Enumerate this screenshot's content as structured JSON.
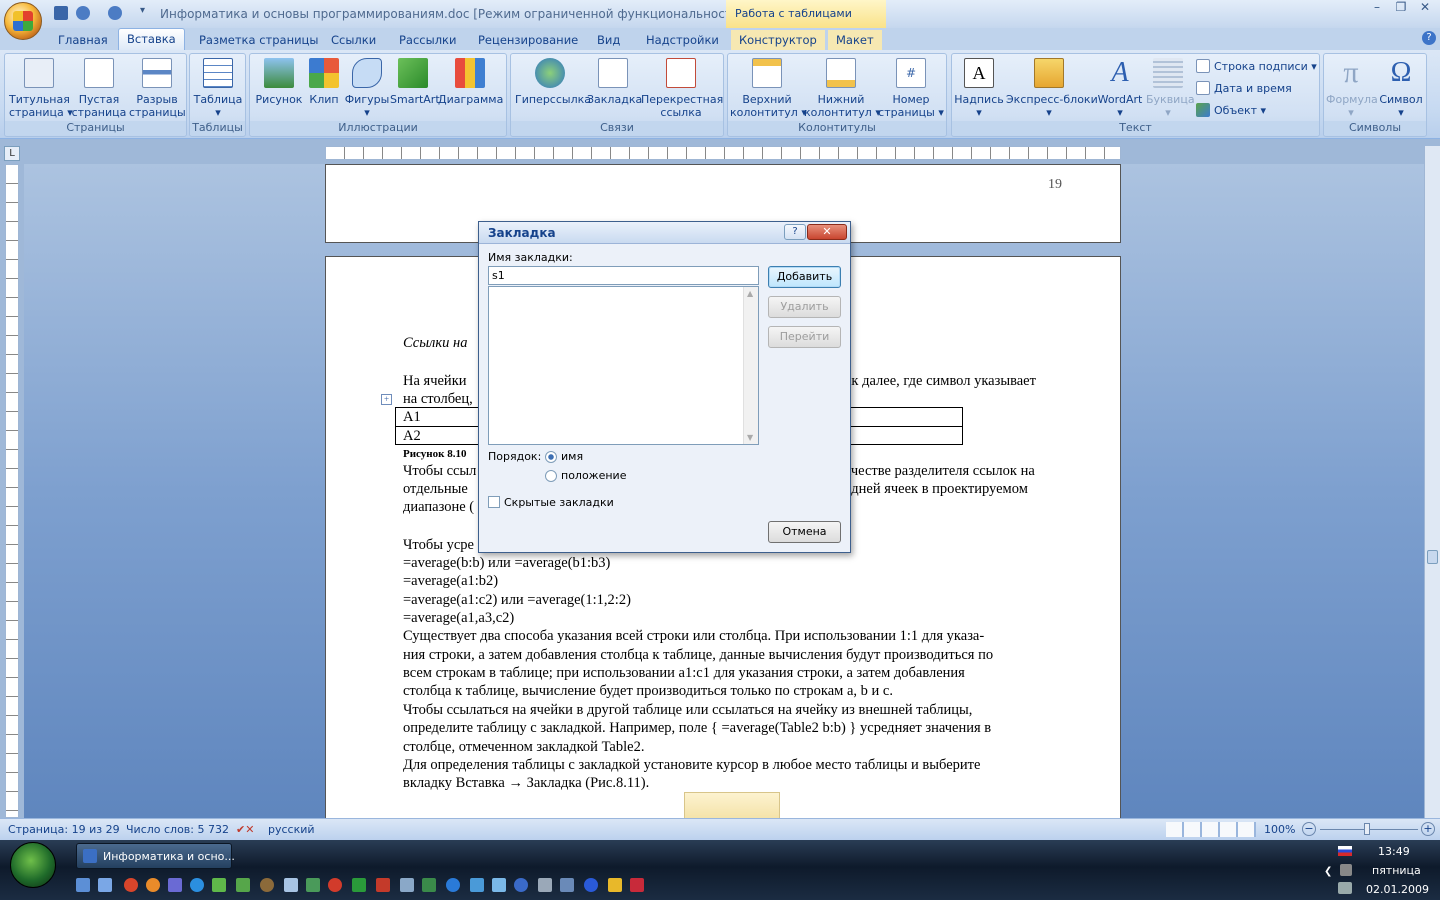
{
  "window": {
    "title": "Информатика и основы программированиям.doc [Режим ограниченной функциональности] - M...",
    "context_tab_title": "Работа с таблицами"
  },
  "tabs": [
    "Главная",
    "Вставка",
    "Разметка страницы",
    "Ссылки",
    "Рассылки",
    "Рецензирование",
    "Вид",
    "Надстройки",
    "Конструктор",
    "Макет"
  ],
  "ribbon": {
    "groups": [
      "Страницы",
      "Таблицы",
      "Иллюстрации",
      "Связи",
      "Колонтитулы",
      "Текст",
      "Символы"
    ],
    "pages": {
      "cover": "Титульная",
      "cover2": "страница ▾",
      "blank": "Пустая",
      "blank2": "страница",
      "break": "Разрыв",
      "break2": "страницы"
    },
    "tables": {
      "table": "Таблица",
      "table2": "▾"
    },
    "illustrations": {
      "picture": "Рисунок",
      "clip": "Клип",
      "shapes": "Фигуры",
      "shapes2": "▾",
      "smartart": "SmartArt",
      "chart": "Диаграмма"
    },
    "links": {
      "hyperlink": "Гиперссылка",
      "bookmark": "Закладка",
      "crossref": "Перекрестная",
      "crossref2": "ссылка"
    },
    "headers": {
      "header": "Верхний",
      "header2": "колонтитул ▾",
      "footer": "Нижний",
      "footer2": "колонтитул ▾",
      "pagenum": "Номер",
      "pagenum2": "страницы ▾"
    },
    "text": {
      "textbox": "Надпись",
      "quickparts": "Экспресс-блоки",
      "wordart": "WordArt",
      "dropcap": "Буквица",
      "signature": "Строка подписи ▾",
      "datetime": "Дата и время",
      "object": "Объект ▾"
    },
    "symbols": {
      "formula": "Формула",
      "symbol": "Символ"
    }
  },
  "document": {
    "page_number": "19",
    "lines": [
      "Ссылки на",
      "На ячейки",
      "ак далее, где символ указывает",
      "на столбец,",
      "A1",
      "A2",
      "Рисунок 8.10",
      "Чтобы ссыл",
      "ачестве разделителя ссылок на",
      "отдельные",
      "едней ячеек в проектируемом",
      "диапазоне (",
      "Чтобы усре",
      "=average(b:b) или =average(b1:b3)",
      "=average(a1:b2)",
      "=average(a1:c2) или =average(1:1,2:2)",
      "=average(a1,a3,c2)",
      "Существует два способа указания всей строки или столбца. При использовании 1:1 для указа-",
      "ния строки, а затем добавления столбца к таблице, данные вычисления будут производиться по",
      "всем строкам в таблице; при использовании a1:c1 для указания строки, а затем добавления",
      "столбца к таблице, вычисление будет производиться только по строкам a, b и c.",
      "Чтобы ссылаться на ячейки в другой таблице или ссылаться на ячейку из внешней таблицы,",
      "определите таблицу с закладкой. Например, поле { =average(Table2 b:b) } усредняет значения в",
      "столбце, отмеченном закладкой Table2.",
      "Для определения таблицы с закладкой установите курсор в любое место таблицы и выберите",
      "вкладку Вставка → Закладка (Рис.8.11)."
    ]
  },
  "dialog": {
    "title": "Закладка",
    "help": "?",
    "close": "✕",
    "name_label": "Имя закладки:",
    "name_value": "s1",
    "add": "Добавить",
    "delete": "Удалить",
    "goto": "Перейти",
    "order_label": "Порядок:",
    "order_name": "имя",
    "order_position": "положение",
    "hidden": "Скрытые закладки",
    "cancel": "Отмена"
  },
  "status": {
    "page": "Страница: 19 из 29",
    "words": "Число слов: 5 732",
    "lang": "русский",
    "zoom": "100%"
  },
  "taskbar": {
    "item": "Информатика и осно...",
    "time": "13:49",
    "day": "пятница",
    "date": "02.01.2009"
  }
}
